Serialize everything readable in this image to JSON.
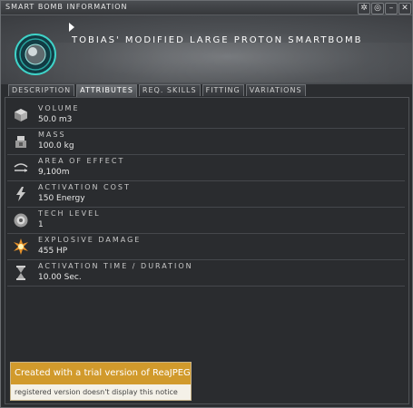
{
  "window": {
    "title": "SMART BOMB INFORMATION",
    "buttons": {
      "pin": "✲",
      "settings": "◎",
      "minimize": "–",
      "close": "✕"
    }
  },
  "item": {
    "name": "TOBIAS' MODIFIED LARGE PROTON SMARTBOMB",
    "icon": "proton-smartbomb-icon",
    "accent_color": "#3fd3c8"
  },
  "tabs": [
    {
      "label": "DESCRIPTION",
      "active": false
    },
    {
      "label": "ATTRIBUTES",
      "active": true
    },
    {
      "label": "REQ. SKILLS",
      "active": false
    },
    {
      "label": "FITTING",
      "active": false
    },
    {
      "label": "VARIATIONS",
      "active": false
    }
  ],
  "attributes": [
    {
      "icon": "volume-cube-icon",
      "label": "VOLUME",
      "value": "50.0 m3"
    },
    {
      "icon": "mass-weight-icon",
      "label": "MASS",
      "value": "100.0 kg"
    },
    {
      "icon": "area-of-effect-icon",
      "label": "AREA OF EFFECT",
      "value": "9,100m"
    },
    {
      "icon": "activation-cost-icon",
      "label": "ACTIVATION COST",
      "value": "150 Energy"
    },
    {
      "icon": "tech-level-icon",
      "label": "TECH LEVEL",
      "value": "1"
    },
    {
      "icon": "explosive-damage-icon",
      "label": "EXPLOSIVE DAMAGE",
      "value": "455 HP"
    },
    {
      "icon": "hourglass-icon",
      "label": "ACTIVATION TIME / DURATION",
      "value": "10.00 Sec."
    }
  ],
  "watermark": {
    "line1": "Created with a trial version of ReaJPEG",
    "line2": "registered version doesn't display this notice"
  }
}
